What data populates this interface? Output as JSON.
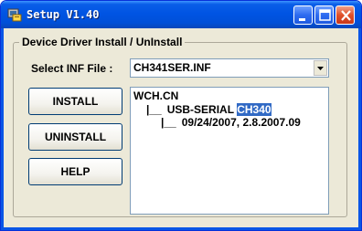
{
  "window": {
    "title": "Setup V1.40",
    "colors": {
      "titlebar": "#0054e3",
      "face": "#ece9d8",
      "close": "#e0502a",
      "selection": "#316ac5"
    }
  },
  "titlebar_buttons": {
    "minimize_icon": "minimize-icon",
    "maximize_icon": "maximize-icon",
    "close_icon": "close-icon"
  },
  "group": {
    "label": "Device Driver Install / UnInstall"
  },
  "inf_file": {
    "label": "Select INF File :",
    "value": "CH341SER.INF"
  },
  "buttons": {
    "install": "INSTALL",
    "uninstall": "UNINSTALL",
    "help": "HELP"
  },
  "driver_tree": {
    "root": "WCH.CN",
    "branch_glyph": "|__",
    "device_prefix": "USB-SERIAL",
    "device_selected": "CH340",
    "version": "09/24/2007, 2.8.2007.09"
  }
}
